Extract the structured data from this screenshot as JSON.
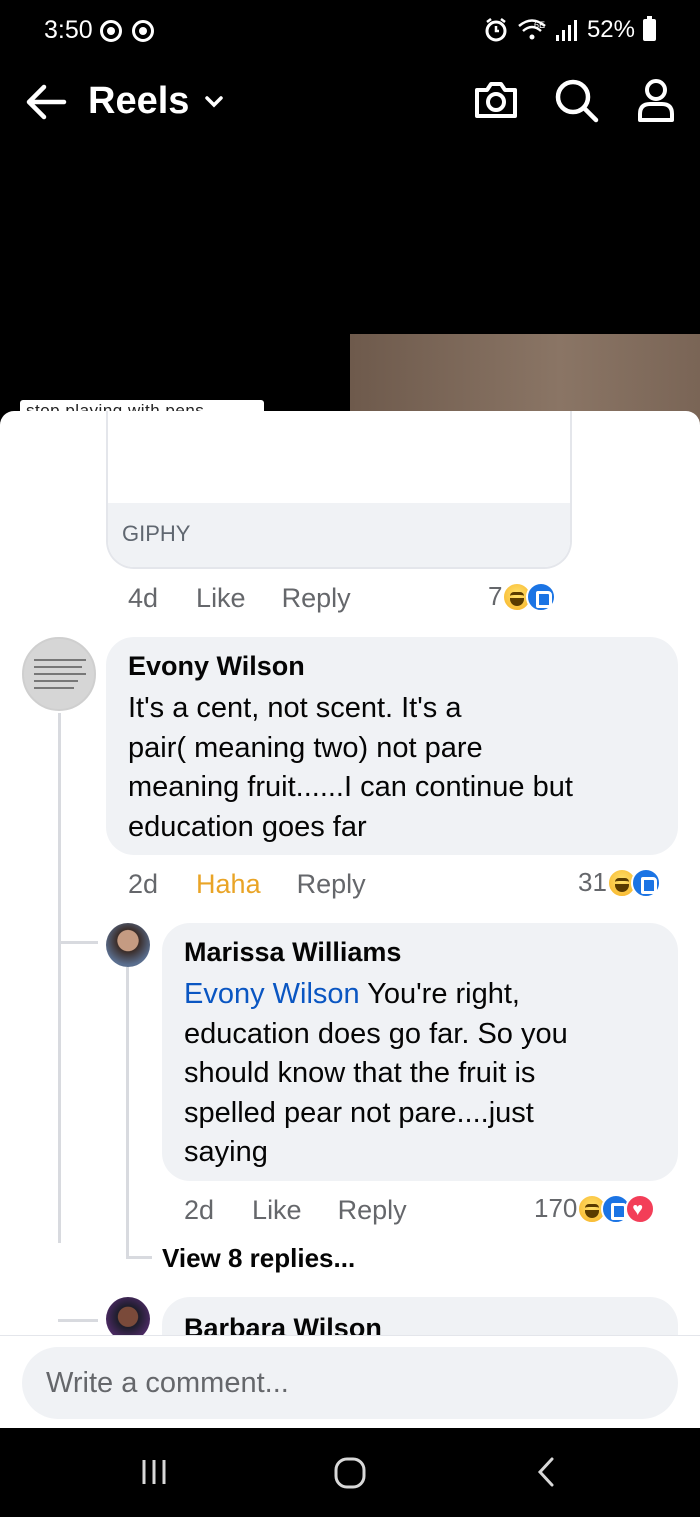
{
  "status_bar": {
    "time": "3:50",
    "network": "6E",
    "battery": "52%"
  },
  "header": {
    "title": "Reels",
    "icons": [
      "back-arrow-icon",
      "chevron-down-icon",
      "camera-icon",
      "search-icon",
      "profile-icon"
    ]
  },
  "video": {
    "sticker_text": "stop playing with pens"
  },
  "giphy": {
    "label": "GIPHY",
    "time": "4d",
    "like": "Like",
    "reply": "Reply",
    "reaction_count": "7"
  },
  "comments": [
    {
      "author": "Evony Wilson",
      "text": "It's a cent, not scent. It's a\npair( meaning two) not pare\nmeaning fruit......I can continue but\neducation goes far",
      "time": "2d",
      "reaction_label": "Haha",
      "reply": "Reply",
      "reaction_count": "31",
      "reactions": [
        "haha",
        "like"
      ]
    },
    {
      "author": "Marissa Williams",
      "mention": "Evony Wilson",
      "text_first_line": " You're right,",
      "text_rest": "education does go far. So you\nshould know that the fruit is\nspelled pear not pare....just\nsaying",
      "time": "2d",
      "like": "Like",
      "reply": "Reply",
      "reaction_count": "170",
      "reactions": [
        "haha",
        "like",
        "love"
      ]
    },
    {
      "author": "Barbara Wilson"
    }
  ],
  "view_replies": "View 8 replies...",
  "composer": {
    "placeholder": "Write a comment..."
  },
  "nav_bar": {
    "icons": [
      "recent-apps-icon",
      "home-icon",
      "back-icon"
    ]
  }
}
